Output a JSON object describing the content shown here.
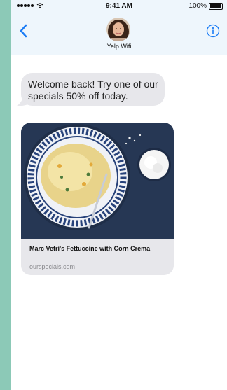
{
  "status_bar": {
    "time": "9:41 AM",
    "battery": "100%"
  },
  "header": {
    "contact_name": "Yelp Wifi"
  },
  "messages": [
    {
      "text": "Welcome back! Try one of our specials 50% off today."
    }
  ],
  "link_card": {
    "title": "Marc Vetri's Fettuccine with Corn Crema",
    "url": "ourspecials.com"
  },
  "icons": [
    "signal-dots-icon",
    "wifi-icon",
    "battery-icon",
    "back-chevron-icon",
    "info-icon"
  ],
  "colors": {
    "accent": "#1a7cf5",
    "bubble": "#e7e7eb",
    "header_bg": "#eef6fc",
    "frame_bg": "#8cc9b7"
  }
}
